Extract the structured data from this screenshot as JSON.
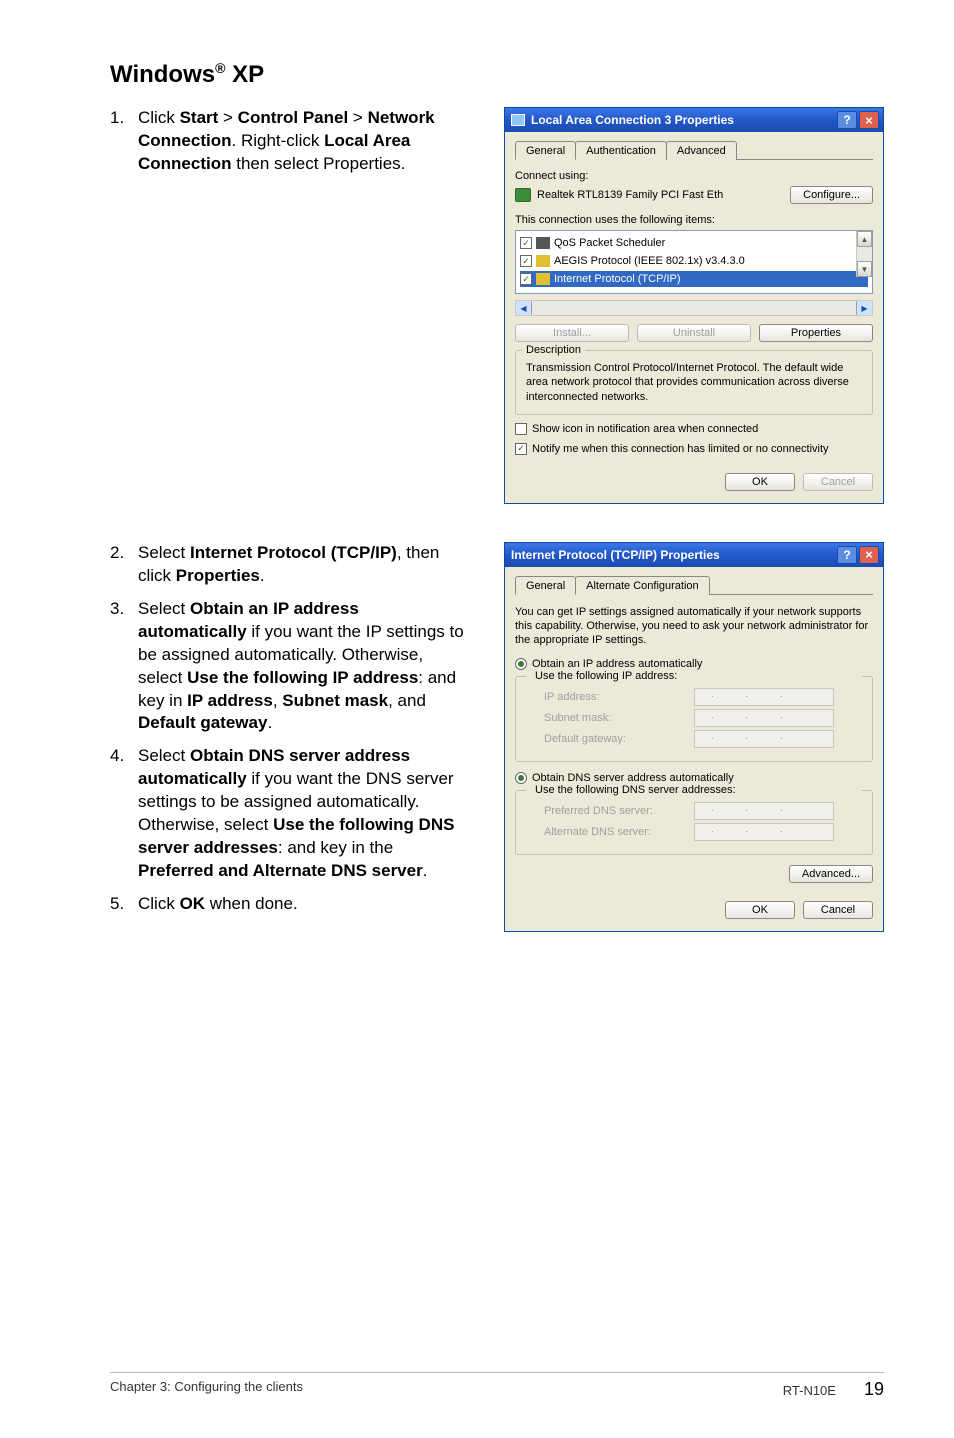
{
  "heading": {
    "base": "Windows",
    "reg": "®",
    "tail": " XP"
  },
  "steps_top": {
    "num": "1.",
    "t_click": "Click ",
    "start": "Start",
    "gt1": " > ",
    "cp": "Control Panel",
    "gt2": " > ",
    "nc": "Network Connection",
    "t_right": ". Right-click ",
    "lac": "Local Area Connection",
    "t_then": " then select Properties."
  },
  "steps_bottom": [
    {
      "num": "2.",
      "parts": [
        "Select ",
        "Internet Protocol (TCP/IP)",
        ", then click ",
        "Properties",
        "."
      ]
    },
    {
      "num": "3.",
      "parts": [
        "Select ",
        "Obtain an IP address automatically",
        " if you want the IP settings to be assigned automatically. Otherwise, select ",
        "Use the following IP address",
        ": and key in ",
        "IP address",
        ", ",
        "Subnet mask",
        ", and ",
        "Default gateway",
        "."
      ]
    },
    {
      "num": "4.",
      "parts": [
        "Select ",
        "Obtain DNS server address automatically",
        " if you want the DNS server settings to be assigned automatically. Otherwise, select ",
        "Use the following DNS server addresses",
        ": and key in the ",
        "Preferred and Alternate DNS server",
        "."
      ]
    },
    {
      "num": "5.",
      "parts": [
        "Click ",
        "OK",
        " when done."
      ]
    }
  ],
  "dlg1": {
    "title": "Local Area Connection 3 Properties",
    "tabs": [
      "General",
      "Authentication",
      "Advanced"
    ],
    "connect_using": "Connect using:",
    "adapter": "Realtek RTL8139 Family PCI Fast Eth",
    "configure": "Configure...",
    "uses": "This connection uses the following items:",
    "items": [
      {
        "label": "QoS Packet Scheduler",
        "selected": false
      },
      {
        "label": "AEGIS Protocol (IEEE 802.1x) v3.4.3.0",
        "selected": false
      },
      {
        "label": "Internet Protocol (TCP/IP)",
        "selected": true
      }
    ],
    "install": "Install...",
    "uninstall": "Uninstall",
    "properties": "Properties",
    "desc_legend": "Description",
    "desc_text": "Transmission Control Protocol/Internet Protocol. The default wide area network protocol that provides communication across diverse interconnected networks.",
    "show_icon": "Show icon in notification area when connected",
    "notify": "Notify me when this connection has limited or no connectivity",
    "ok": "OK",
    "cancel": "Cancel"
  },
  "dlg2": {
    "title": "Internet Protocol (TCP/IP) Properties",
    "tabs": [
      "General",
      "Alternate Configuration"
    ],
    "info": "You can get IP settings assigned automatically if your network supports this capability. Otherwise, you need to ask your network administrator for the appropriate IP settings.",
    "r_obtain_ip": "Obtain an IP address automatically",
    "r_use_ip": "Use the following IP address:",
    "ip_address": "IP address:",
    "subnet": "Subnet mask:",
    "gateway": "Default gateway:",
    "r_obtain_dns": "Obtain DNS server address automatically",
    "r_use_dns": "Use the following DNS server addresses:",
    "pref_dns": "Preferred DNS server:",
    "alt_dns": "Alternate DNS server:",
    "advanced": "Advanced...",
    "ok": "OK",
    "cancel": "Cancel"
  },
  "footer": {
    "left": "Chapter 3: Configuring the clients",
    "model": "RT-N10E",
    "page": "19"
  }
}
